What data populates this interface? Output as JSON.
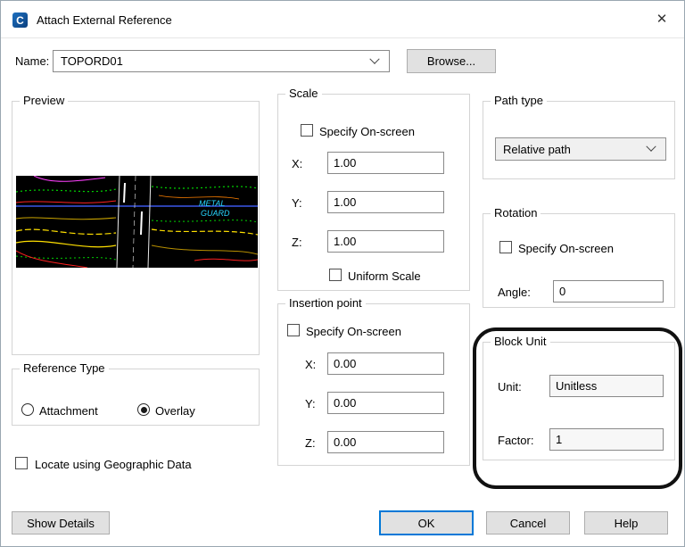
{
  "window": {
    "title": "Attach External Reference",
    "close_glyph": "✕",
    "app_icon_glyph": "C"
  },
  "name_row": {
    "label": "Name:",
    "value": "TOPORD01",
    "browse": "Browse..."
  },
  "preview": {
    "label": "Preview",
    "texts": {
      "metal": "METAL",
      "guard": "GUARD"
    }
  },
  "reference_type": {
    "label": "Reference Type",
    "options": [
      {
        "label": "Attachment",
        "selected": false
      },
      {
        "label": "Overlay",
        "selected": true
      }
    ]
  },
  "geo": {
    "label": "Locate using Geographic Data",
    "checked": false
  },
  "scale": {
    "label": "Scale",
    "specify": "Specify On-screen",
    "uniform": "Uniform Scale",
    "fields": [
      {
        "label": "X:",
        "value": "1.00"
      },
      {
        "label": "Y:",
        "value": "1.00"
      },
      {
        "label": "Z:",
        "value": "1.00"
      }
    ]
  },
  "insertion": {
    "label": "Insertion point",
    "specify": "Specify On-screen",
    "fields": [
      {
        "label": "X:",
        "value": "0.00"
      },
      {
        "label": "Y:",
        "value": "0.00"
      },
      {
        "label": "Z:",
        "value": "0.00"
      }
    ]
  },
  "path_type": {
    "label": "Path type",
    "value": "Relative path"
  },
  "rotation": {
    "label": "Rotation",
    "specify": "Specify On-screen",
    "angle_label": "Angle:",
    "angle_value": "0"
  },
  "block_unit": {
    "label": "Block Unit",
    "unit_label": "Unit:",
    "unit_value": "Unitless",
    "factor_label": "Factor:",
    "factor_value": "1"
  },
  "footer": {
    "show_details": "Show Details",
    "ok": "OK",
    "cancel": "Cancel",
    "help": "Help"
  },
  "colors": {
    "default_button_border": "#0078d7",
    "annotation": "#111111",
    "preview_bg": "#000000"
  }
}
